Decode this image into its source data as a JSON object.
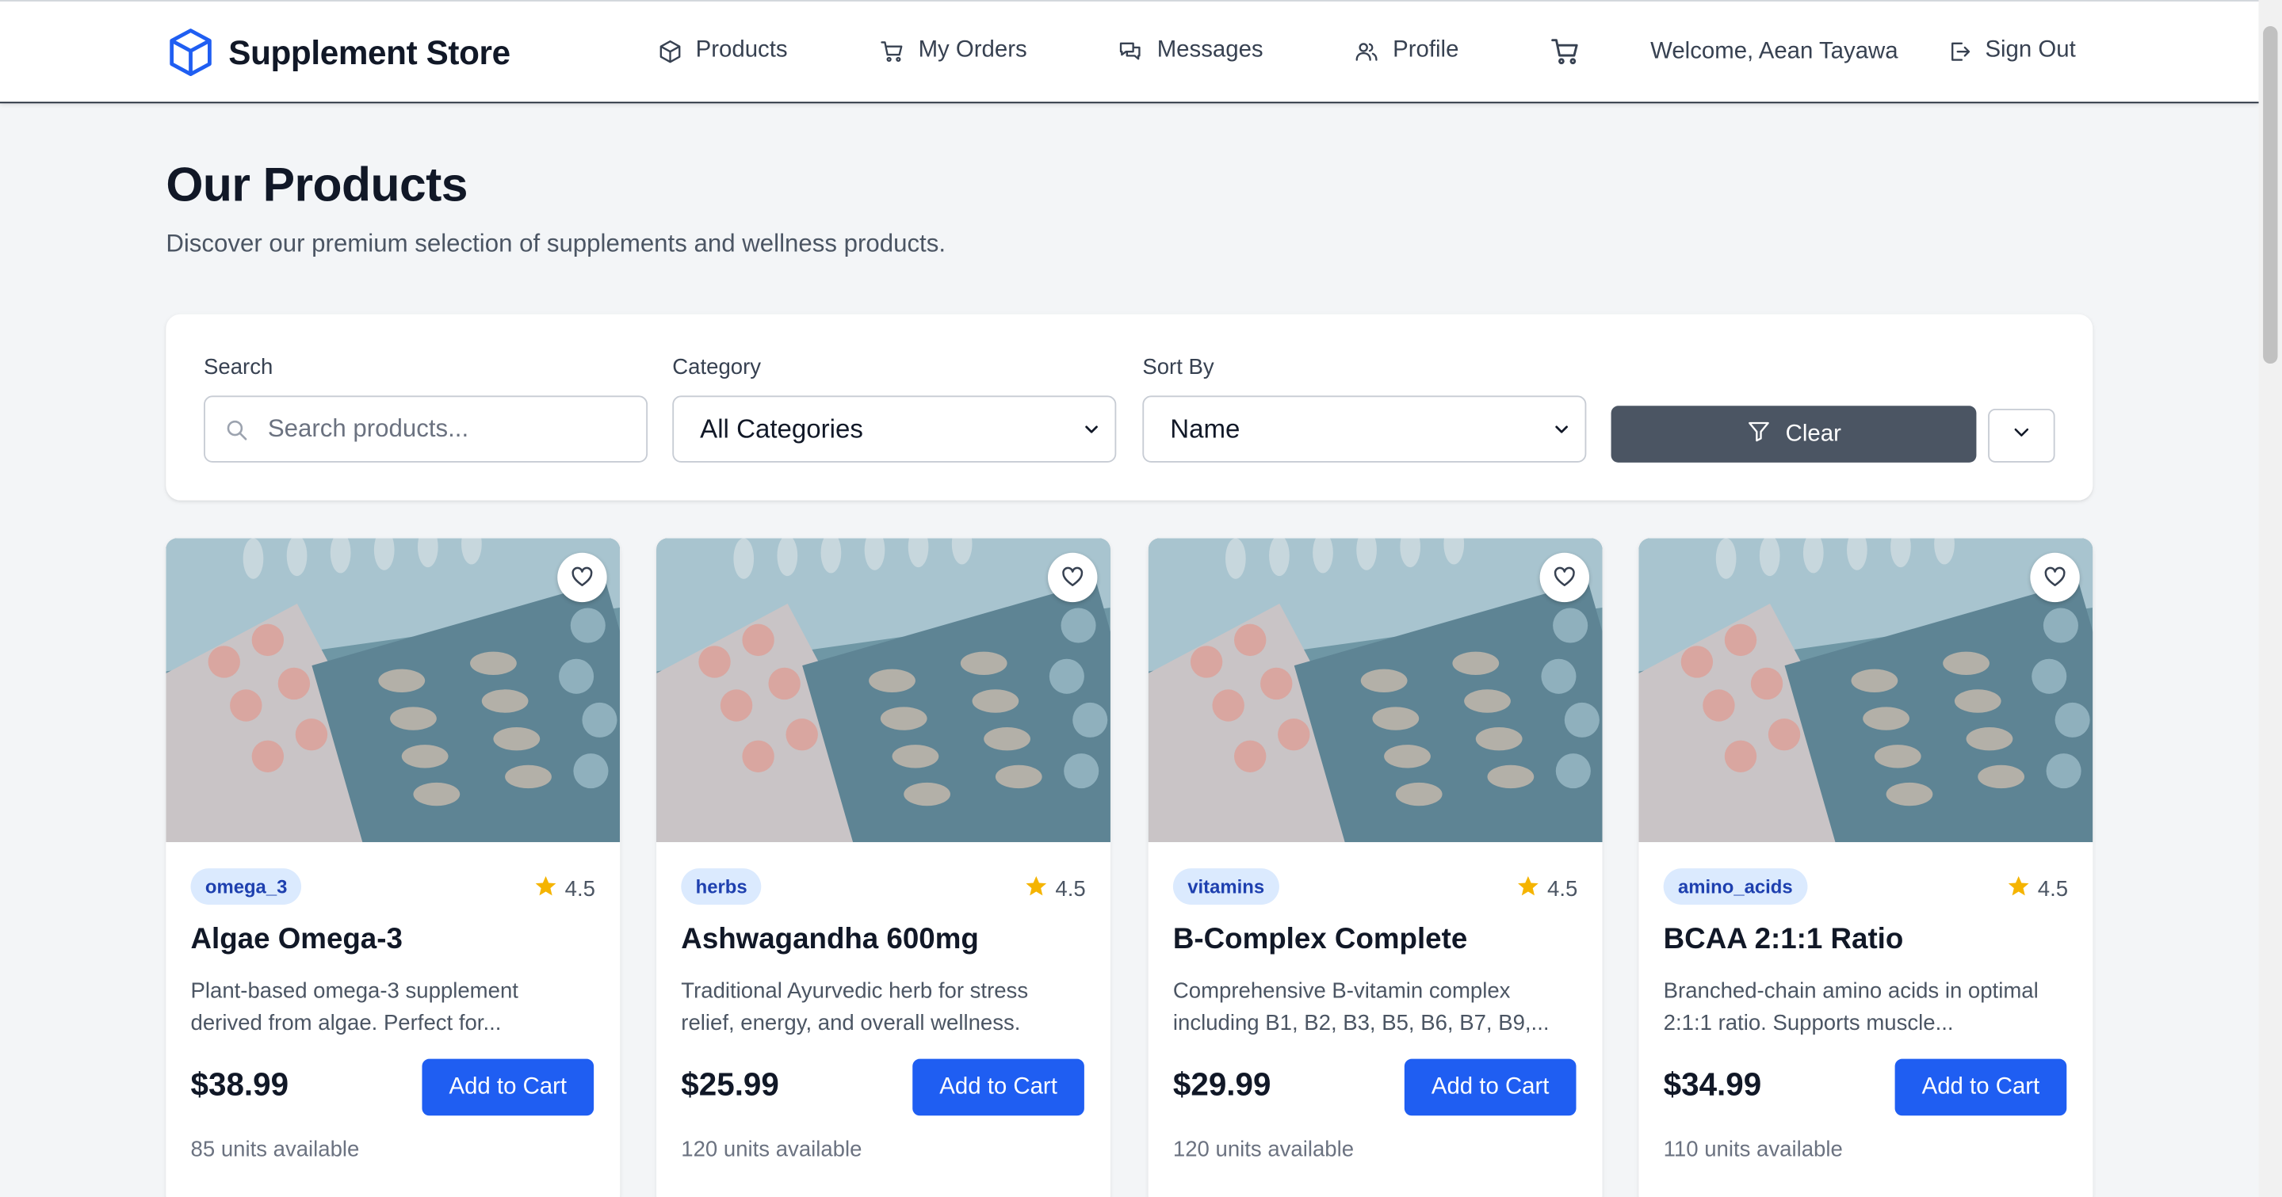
{
  "header": {
    "brand": "Supplement Store",
    "nav": [
      {
        "label": "Products",
        "icon": "box-icon"
      },
      {
        "label": "My Orders",
        "icon": "cart-icon"
      },
      {
        "label": "Messages",
        "icon": "chat-icon"
      },
      {
        "label": "Profile",
        "icon": "users-icon"
      }
    ],
    "cart_icon": "cart-icon",
    "welcome": "Welcome, Aean Tayawa",
    "signout": "Sign Out"
  },
  "page": {
    "title": "Our Products",
    "subtitle": "Discover our premium selection of supplements and wellness products."
  },
  "filters": {
    "search_label": "Search",
    "search_placeholder": "Search products...",
    "category_label": "Category",
    "category_value": "All Categories",
    "sort_label": "Sort By",
    "sort_value": "Name",
    "clear_label": "Clear"
  },
  "products": [
    {
      "category": "omega_3",
      "rating": "4.5",
      "name": "Algae Omega-3",
      "description": "Plant-based omega-3 supplement derived from algae. Perfect for...",
      "price": "$38.99",
      "cta": "Add to Cart",
      "stock": "85 units available"
    },
    {
      "category": "herbs",
      "rating": "4.5",
      "name": "Ashwagandha 600mg",
      "description": "Traditional Ayurvedic herb for stress relief, energy, and overall wellness.",
      "price": "$25.99",
      "cta": "Add to Cart",
      "stock": "120 units available"
    },
    {
      "category": "vitamins",
      "rating": "4.5",
      "name": "B-Complex Complete",
      "description": "Comprehensive B-vitamin complex including B1, B2, B3, B5, B6, B7, B9,...",
      "price": "$29.99",
      "cta": "Add to Cart",
      "stock": "120 units available"
    },
    {
      "category": "amino_acids",
      "rating": "4.5",
      "name": "BCAA 2:1:1 Ratio",
      "description": "Branched-chain amino acids in optimal 2:1:1 ratio. Supports muscle...",
      "price": "$34.99",
      "cta": "Add to Cart",
      "stock": "110 units available"
    }
  ],
  "colors": {
    "primary": "#1f5ef2",
    "brand_icon": "#1f5ef2",
    "clear_button": "#4b5563",
    "badge_bg": "#dbeafe",
    "badge_text": "#1e40af",
    "star": "#f5b400"
  }
}
